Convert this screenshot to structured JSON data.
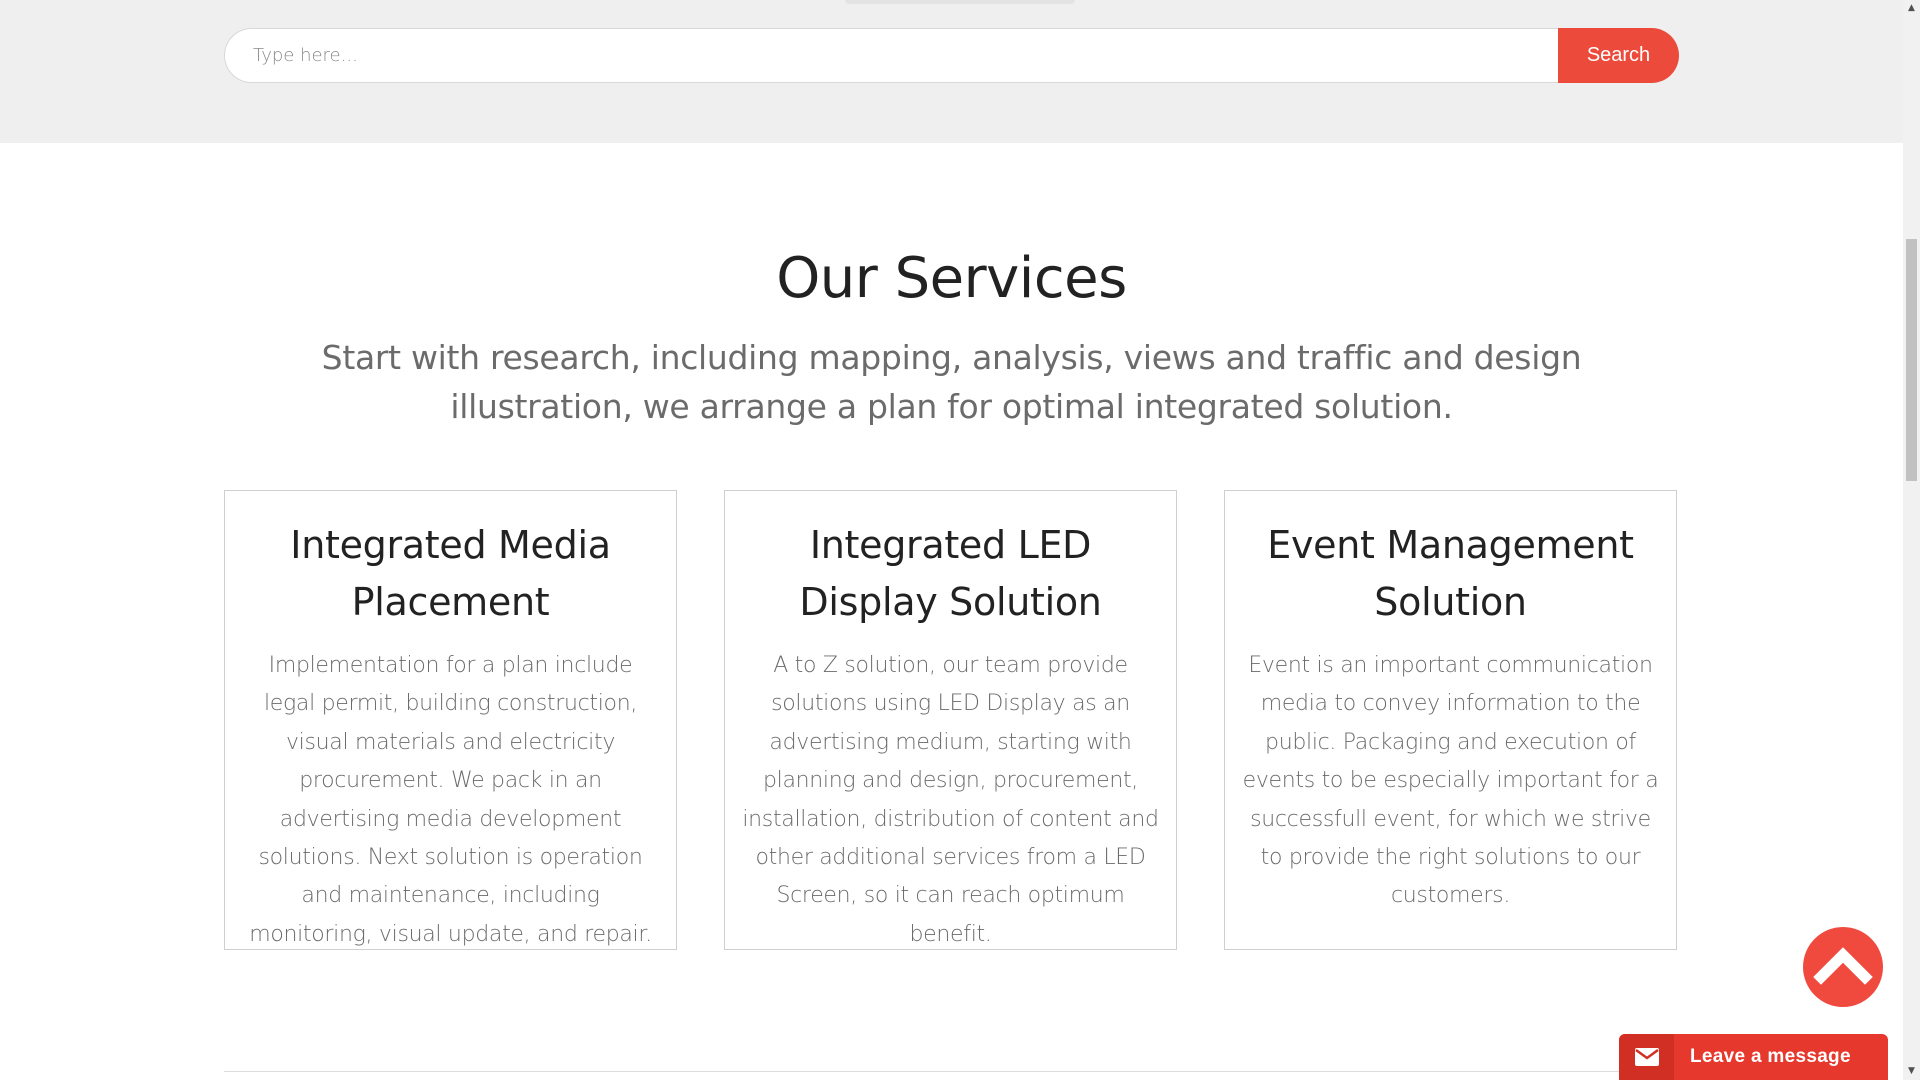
{
  "search": {
    "placeholder": "Type here...",
    "button_label": "Search"
  },
  "services": {
    "title": "Our Services",
    "subtitle": "Start with research, including mapping, analysis, views and traffic and design illustration, we arrange a plan for optimal integrated solution.",
    "cards": [
      {
        "title": "Integrated Media Placement",
        "description": "Implementation for a plan include legal permit, building construction, visual materials and electricity procurement. We pack in an advertising media development solutions. Next solution is operation and maintenance, including monitoring, visual update, and repair."
      },
      {
        "title": "Integrated LED Display Solution",
        "description": "A to Z solution, our team provide solutions using LED Display as an advertising medium, starting with planning and design, procurement, installation, distribution of content and other additional services from a LED Screen, so it can reach optimum benefit."
      },
      {
        "title": "Event Management Solution",
        "description": "Event is an important communication media to convey information to the public. Packaging and execution of events to be especially important for a successfull event, for which we strive to provide the right solutions to our customers."
      }
    ]
  },
  "widgets": {
    "scroll_top_icon": "chevron-up-icon",
    "leave_message_label": "Leave a message",
    "leave_message_icon": "mail-icon"
  },
  "colors": {
    "accent": "#ec4b3c",
    "band_background": "#efefef"
  }
}
